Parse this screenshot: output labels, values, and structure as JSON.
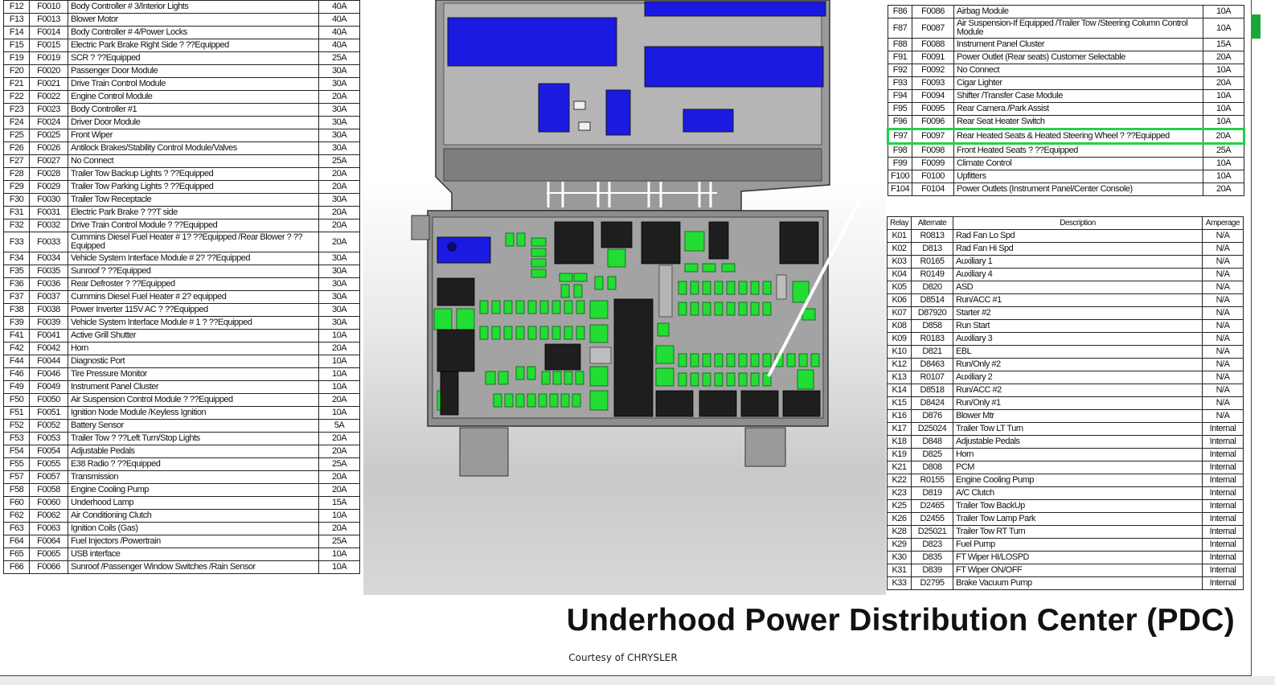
{
  "title": "Underhood Power Distribution Center (PDC)",
  "courtesy": "Courtesy of CHRYSLER",
  "colors": {
    "accent_green": "#21d14a",
    "relay_blue": "#1a1ae0",
    "fuse_green": "#22dd33",
    "housing_gray": "#8a8a8a"
  },
  "left_fuses": [
    [
      "F12",
      "F0010",
      "Body Controller # 3/Interior Lights",
      "40A"
    ],
    [
      "F13",
      "F0013",
      "Blower Motor",
      "40A"
    ],
    [
      "F14",
      "F0014",
      "Body Controller # 4/Power Locks",
      "40A"
    ],
    [
      "F15",
      "F0015",
      "Electric Park Brake Right Side ? ??Equipped",
      "40A"
    ],
    [
      "F19",
      "F0019",
      "SCR ? ??Equipped",
      "25A"
    ],
    [
      "F20",
      "F0020",
      "Passenger Door Module",
      "30A"
    ],
    [
      "F21",
      "F0021",
      "Drive Train Control Module",
      "30A"
    ],
    [
      "F22",
      "F0022",
      "Engine Control Module",
      "20A"
    ],
    [
      "F23",
      "F0023",
      "Body Controller #1",
      "30A"
    ],
    [
      "F24",
      "F0024",
      "Driver Door Module",
      "30A"
    ],
    [
      "F25",
      "F0025",
      "Front Wiper",
      "30A"
    ],
    [
      "F26",
      "F0026",
      "Antilock Brakes/Stability Control Module/Valves",
      "30A"
    ],
    [
      "F27",
      "F0027",
      "No Connect",
      "25A"
    ],
    [
      "F28",
      "F0028",
      "Trailer Tow Backup Lights ? ??Equipped",
      "20A"
    ],
    [
      "F29",
      "F0029",
      "Trailer Tow Parking Lights ? ??Equipped",
      "20A"
    ],
    [
      "F30",
      "F0030",
      "Trailer Tow Receptacle",
      "30A"
    ],
    [
      "F31",
      "F0031",
      "Electric Park Brake ? ??T side",
      "20A"
    ],
    [
      "F32",
      "F0032",
      "Drive Train Control Module ? ??Equipped",
      "20A"
    ],
    [
      "F33",
      "F0033",
      "Cummins Diesel Fuel Heater # 1? ??Equipped /Rear Blower ? ?? Equipped",
      "20A"
    ],
    [
      "F34",
      "F0034",
      "Vehicle System Interface Module # 2? ??Equipped",
      "30A"
    ],
    [
      "F35",
      "F0035",
      "Sunroof ? ??Equipped",
      "30A"
    ],
    [
      "F36",
      "F0036",
      "Rear Defroster ? ??Equipped",
      "30A"
    ],
    [
      "F37",
      "F0037",
      "Cummins Diesel Fuel Heater # 2? equipped",
      "30A"
    ],
    [
      "F38",
      "F0038",
      "Power Inverter 115V AC ? ??Equipped",
      "30A"
    ],
    [
      "F39",
      "F0039",
      "Vehicle System Interface Module # 1 ? ??Equipped",
      "30A"
    ],
    [
      "F41",
      "F0041",
      "Active Grill Shutter",
      "10A"
    ],
    [
      "F42",
      "F0042",
      "Horn",
      "20A"
    ],
    [
      "F44",
      "F0044",
      "Diagnostic Port",
      "10A"
    ],
    [
      "F46",
      "F0046",
      "Tire Pressure Monitor",
      "10A"
    ],
    [
      "F49",
      "F0049",
      "Instrument Panel Cluster",
      "10A"
    ],
    [
      "F50",
      "F0050",
      "Air Suspension Control Module ? ??Equipped",
      "20A"
    ],
    [
      "F51",
      "F0051",
      "Ignition Node Module /Keyless Ignition",
      "10A"
    ],
    [
      "F52",
      "F0052",
      "Battery Sensor",
      "5A"
    ],
    [
      "F53",
      "F0053",
      "Trailer Tow ? ??Left Turn/Stop Lights",
      "20A"
    ],
    [
      "F54",
      "F0054",
      "Adjustable Pedals",
      "20A"
    ],
    [
      "F55",
      "F0055",
      "E38 Radio ? ??Equipped",
      "25A"
    ],
    [
      "F57",
      "F0057",
      "Transmission",
      "20A"
    ],
    [
      "F58",
      "F0058",
      "Engine Cooling Pump",
      "20A"
    ],
    [
      "F60",
      "F0060",
      "Underhood Lamp",
      "15A"
    ],
    [
      "F62",
      "F0062",
      "Air Conditioning Clutch",
      "10A"
    ],
    [
      "F63",
      "F0063",
      "Ignition Coils (Gas)",
      "20A"
    ],
    [
      "F64",
      "F0064",
      "Fuel Injectors /Powertrain",
      "25A"
    ],
    [
      "F65",
      "F0065",
      "USB interface",
      "10A"
    ],
    [
      "F66",
      "F0066",
      "Sunroof /Passenger Window Switches /Rain Sensor",
      "10A"
    ]
  ],
  "right_fuses": [
    [
      "F86",
      "F0086",
      "Airbag Module",
      "10A"
    ],
    [
      "F87",
      "F0087",
      "Air Suspension-If Equipped /Trailer Tow /Steering Column Control Module",
      "10A"
    ],
    [
      "F88",
      "F0088",
      "Instrument Panel Cluster",
      "15A"
    ],
    [
      "F91",
      "F0091",
      "Power Outlet (Rear seats) Customer Selectable",
      "20A"
    ],
    [
      "F92",
      "F0092",
      "No Connect",
      "10A"
    ],
    [
      "F93",
      "F0093",
      "Cigar Lighter",
      "20A"
    ],
    [
      "F94",
      "F0094",
      "Shifter /Transfer Case Module",
      "10A"
    ],
    [
      "F95",
      "F0095",
      "Rear Camera /Park Assist",
      "10A"
    ],
    [
      "F96",
      "F0096",
      "Rear Seat Heater Switch",
      "10A"
    ],
    [
      "F97",
      "F0097",
      "Rear Heated Seats & Heated Steering Wheel ? ??Equipped",
      "20A"
    ],
    [
      "F98",
      "F0098",
      "Front Heated Seats ? ??Equipped",
      "25A"
    ],
    [
      "F99",
      "F0099",
      "Climate Control",
      "10A"
    ],
    [
      "F100",
      "F0100",
      "Upfitters",
      "10A"
    ],
    [
      "F104",
      "F0104",
      "Power Outlets (Instrument Panel/Center Console)",
      "20A"
    ]
  ],
  "relay_headers": [
    "Relay",
    "Alternate",
    "Description",
    "Amperage"
  ],
  "relays": [
    [
      "K01",
      "R0813",
      "Rad Fan Lo Spd",
      "N/A"
    ],
    [
      "K02",
      "D813",
      "Rad Fan Hi Spd",
      "N/A"
    ],
    [
      "K03",
      "R0165",
      "Auxiliary 1",
      "N/A"
    ],
    [
      "K04",
      "R0149",
      "Auxiliary 4",
      "N/A"
    ],
    [
      "K05",
      "D820",
      "ASD",
      "N/A"
    ],
    [
      "K06",
      "D8514",
      "Run/ACC #1",
      "N/A"
    ],
    [
      "K07",
      "D87920",
      "Starter #2",
      "N/A"
    ],
    [
      "K08",
      "D858",
      "Run Start",
      "N/A"
    ],
    [
      "K09",
      "R0183",
      "Auxiliary 3",
      "N/A"
    ],
    [
      "K10",
      "D821",
      "EBL",
      "N/A"
    ],
    [
      "K12",
      "D8463",
      "Run/Only #2",
      "N/A"
    ],
    [
      "K13",
      "R0107",
      "Auxiliary 2",
      "N/A"
    ],
    [
      "K14",
      "D8518",
      "Run/ACC #2",
      "N/A"
    ],
    [
      "K15",
      "D8424",
      "Run/Only #1",
      "N/A"
    ],
    [
      "K16",
      "D876",
      "Blower Mtr",
      "N/A"
    ],
    [
      "K17",
      "D25024",
      "Trailer Tow LT Turn",
      "Internal"
    ],
    [
      "K18",
      "D848",
      "Adjustable Pedals",
      "Internal"
    ],
    [
      "K19",
      "D825",
      "Horn",
      "Internal"
    ],
    [
      "K21",
      "D808",
      "PCM",
      "Internal"
    ],
    [
      "K22",
      "R0155",
      "Engine Cooling Pump",
      "Internal"
    ],
    [
      "K23",
      "D819",
      "A/C Clutch",
      "Internal"
    ],
    [
      "K25",
      "D2465",
      "Trailer Tow BackUp",
      "Internal"
    ],
    [
      "K26",
      "D2455",
      "Trailer Tow Lamp Park",
      "Internal"
    ],
    [
      "K28",
      "D25021",
      "Trailer Tow RT Turn",
      "Internal"
    ],
    [
      "K29",
      "D823",
      "Fuel Pump",
      "Internal"
    ],
    [
      "K30",
      "D835",
      "FT Wiper HI/LOSPD",
      "Internal"
    ],
    [
      "K31",
      "D839",
      "FT Wiper ON/OFF",
      "Internal"
    ],
    [
      "K33",
      "D2795",
      "Brake Vacuum Pump",
      "Internal"
    ]
  ]
}
